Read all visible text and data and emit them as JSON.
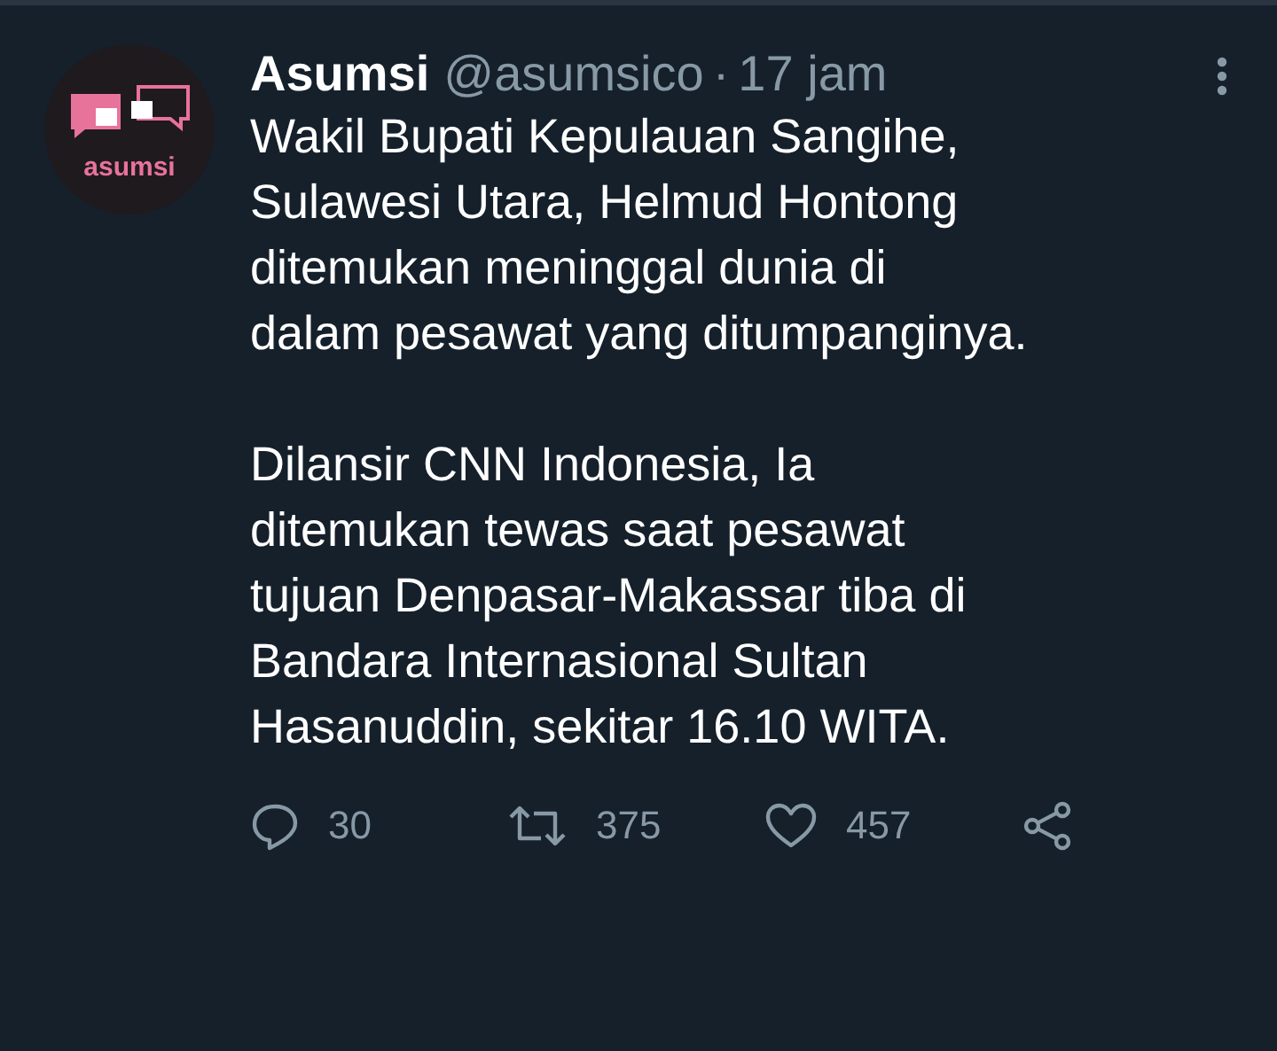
{
  "tweet": {
    "avatar": {
      "label": "asumsi"
    },
    "name": "Asumsi",
    "handle": "@asumsico",
    "separator": "·",
    "time": "17 jam",
    "paragraphs": [
      "Wakil Bupati Kepulauan Sangihe,\nSulawesi Utara, Helmud Hontong\nditemukan meninggal dunia di\ndalam pesawat yang ditumpanginya.",
      "Dilansir CNN Indonesia, Ia\nditemukan tewas saat pesawat\ntujuan Denpasar-Makassar tiba di\nBandara Internasional Sultan\nHasanuddin, sekitar 16.10 WITA."
    ],
    "actions": [
      {
        "kind": "reply",
        "count": "30"
      },
      {
        "kind": "retweet",
        "count": "375"
      },
      {
        "kind": "like",
        "count": "457"
      },
      {
        "kind": "share"
      }
    ]
  }
}
